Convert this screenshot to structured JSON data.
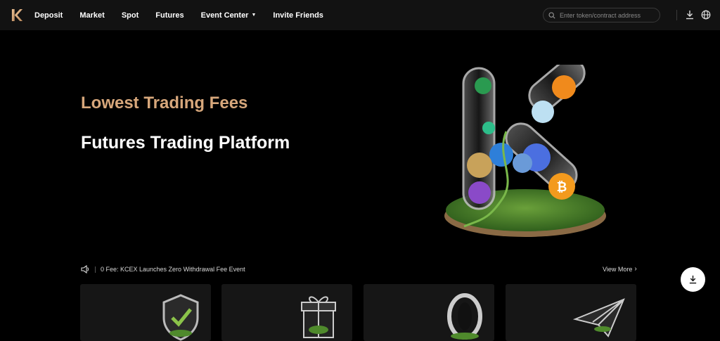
{
  "nav": {
    "logo_icon": "kcex-logo-icon",
    "links": [
      {
        "label": "Deposit"
      },
      {
        "label": "Market"
      },
      {
        "label": "Spot"
      },
      {
        "label": "Futures"
      },
      {
        "label": "Event Center",
        "has_caret": true
      },
      {
        "label": "Invite Friends"
      }
    ],
    "search": {
      "placeholder": "Enter token/contract address",
      "icon": "search-icon"
    },
    "download_icon": "download-icon",
    "language_icon": "globe-icon"
  },
  "hero": {
    "subtitle": "Lowest Trading Fees",
    "title": "Futures Trading Platform",
    "subtitle_color": "#d7a77b"
  },
  "announcement": {
    "icon": "speaker-icon",
    "text": "0 Fee: KCEX Launches Zero Withdrawal Fee Event",
    "view_more": "View More"
  },
  "fab": {
    "icon": "download-icon"
  },
  "cards": [
    {
      "icon": "shield-check-icon"
    },
    {
      "icon": "gift-box-icon"
    },
    {
      "icon": "zero-icon"
    },
    {
      "icon": "paper-plane-icon"
    }
  ]
}
